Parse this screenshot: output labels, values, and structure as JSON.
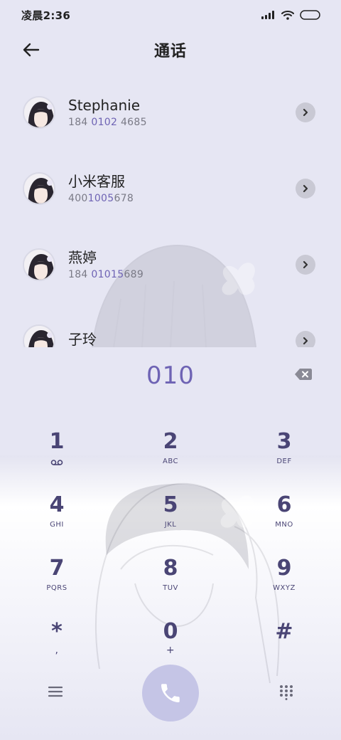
{
  "status_bar": {
    "time": "凌晨2:36",
    "icons": [
      "signal-icon",
      "wifi-icon",
      "battery-icon"
    ]
  },
  "header": {
    "title": "通话",
    "back_icon": "back-arrow-icon"
  },
  "contacts": [
    {
      "name": "Stephanie",
      "number_pre": "184 ",
      "number_match": "0102",
      "number_post": " 4685"
    },
    {
      "name": "小米客服",
      "number_pre": "400",
      "number_match": "1005",
      "number_post": "678"
    },
    {
      "name": "燕婷",
      "number_pre": "184 ",
      "number_match": "01015",
      "number_post": "689"
    },
    {
      "name": "子玲",
      "number_pre": "",
      "number_match": "",
      "number_post": ""
    }
  ],
  "dialer": {
    "number": "010",
    "backspace_icon": "backspace-icon"
  },
  "keypad": [
    {
      "digit": "1",
      "letters": "",
      "sub_icon": "voicemail-icon"
    },
    {
      "digit": "2",
      "letters": "ABC"
    },
    {
      "digit": "3",
      "letters": "DEF"
    },
    {
      "digit": "4",
      "letters": "GHI"
    },
    {
      "digit": "5",
      "letters": "JKL"
    },
    {
      "digit": "6",
      "letters": "MNO"
    },
    {
      "digit": "7",
      "letters": "PQRS"
    },
    {
      "digit": "8",
      "letters": "TUV"
    },
    {
      "digit": "9",
      "letters": "WXYZ"
    },
    {
      "digit": "*",
      "letters": ","
    },
    {
      "digit": "0",
      "letters": "+"
    },
    {
      "digit": "#",
      "letters": ""
    }
  ],
  "bottom_bar": {
    "menu_icon": "menu-icon",
    "call_icon": "phone-icon",
    "dialpad_icon": "dialpad-icon"
  },
  "colors": {
    "accent": "#6e63b4",
    "key_text": "#4a4575",
    "call_button": "#c5c5e6",
    "background": "#e6e6f3"
  }
}
